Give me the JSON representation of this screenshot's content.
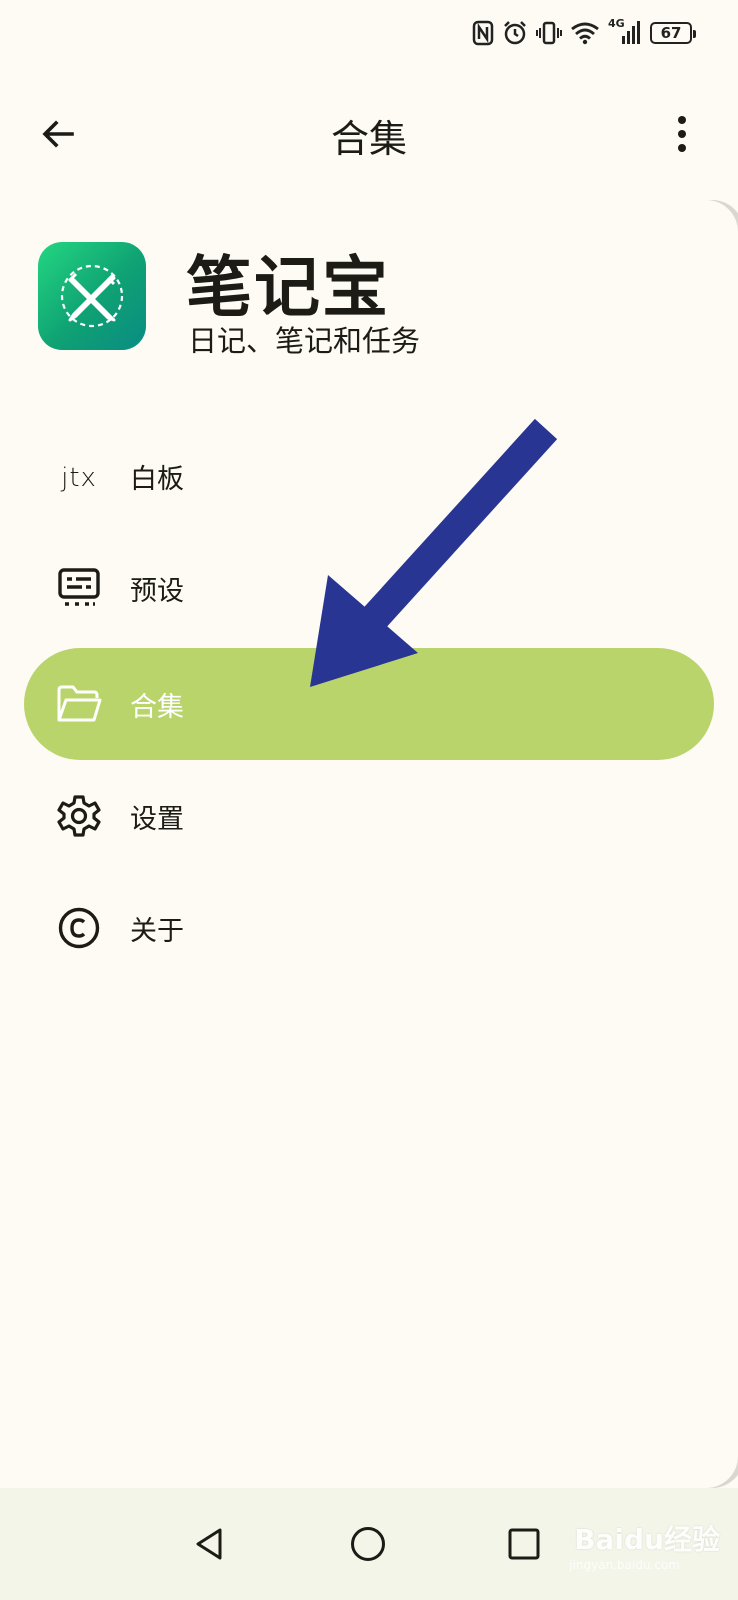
{
  "status_bar": {
    "battery": "67",
    "icons": [
      "nfc-icon",
      "alarm-icon",
      "vibrate-icon",
      "wifi-icon",
      "4g-signal-icon",
      "battery-icon"
    ],
    "network_label": "4G"
  },
  "appbar": {
    "title": "合集",
    "back_icon": "arrow-left-icon",
    "more_icon": "more-vertical-icon"
  },
  "drawer": {
    "app_name": "笔记宝",
    "app_description": "日记、笔记和任务",
    "items": [
      {
        "label": "白板",
        "icon": "jtx-logo-icon",
        "active": false
      },
      {
        "label": "预设",
        "icon": "preset-icon",
        "active": false
      },
      {
        "label": "合集",
        "icon": "folder-icon",
        "active": true
      },
      {
        "label": "设置",
        "icon": "gear-icon",
        "active": false
      },
      {
        "label": "关于",
        "icon": "copyright-icon",
        "active": false
      }
    ],
    "jtx_text": "jtx"
  },
  "system_nav": {
    "buttons": [
      "back-triangle-icon",
      "home-circle-icon",
      "recents-square-icon"
    ]
  },
  "watermark": {
    "text": "Baidu经验",
    "sub": "jingyan.baidu.com"
  },
  "colors": {
    "background": "#fdfbf4",
    "active_item": "#b9d46a",
    "arrow": "#283593",
    "logo_green": "#14b87a"
  }
}
